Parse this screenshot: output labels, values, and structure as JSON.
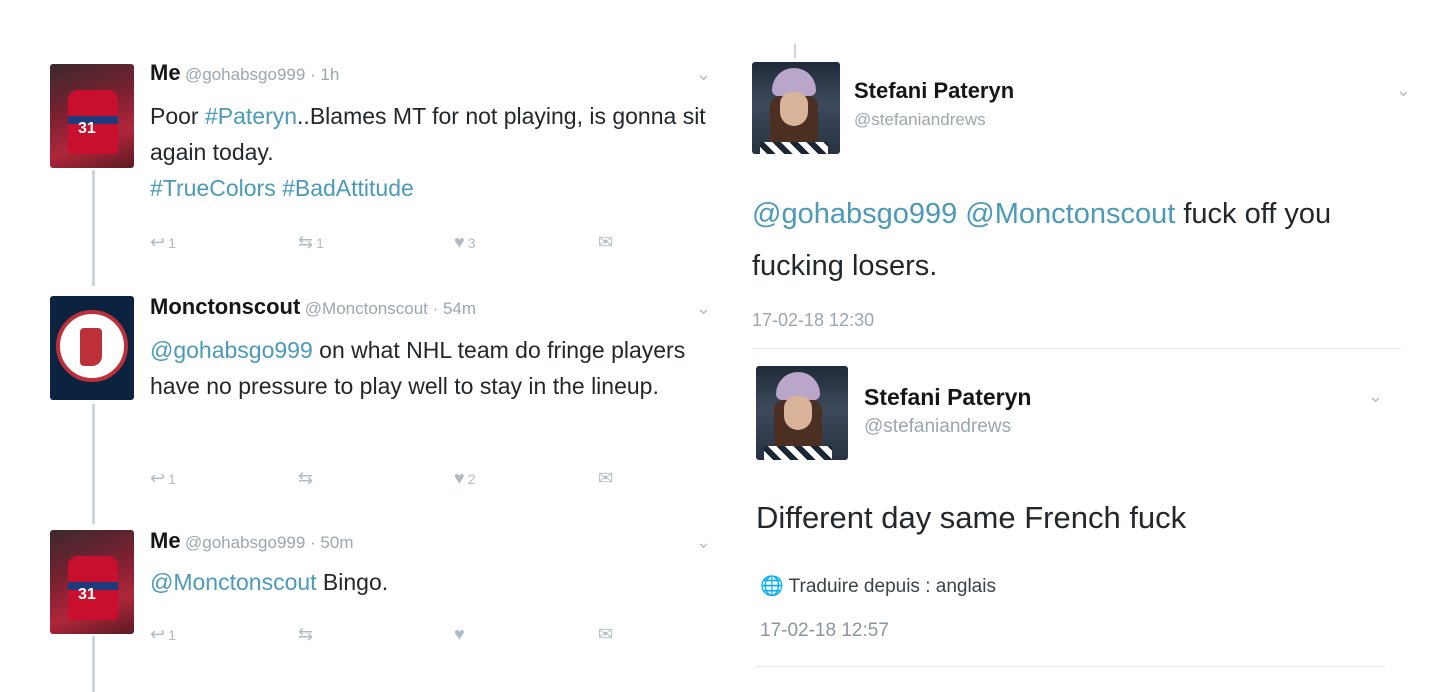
{
  "left_thread": {
    "tweets": [
      {
        "name": "Me",
        "meta": "@gohabsgo999 · 1h",
        "text_parts": [
          {
            "t": "Poor ",
            "link": false
          },
          {
            "t": "#Pateryn",
            "link": true
          },
          {
            "t": "..Blames MT for not playing, is gonna sit again today.",
            "link": false
          }
        ],
        "text_line2": "#TrueColors #BadAttitude",
        "actions": {
          "reply": "1",
          "retweet": "1",
          "like": "3"
        }
      },
      {
        "name": "Monctonscout",
        "meta": "@Monctonscout · 54m",
        "mention": "@gohabsgo999",
        "text": " on what NHL team do fringe players have no pressure to play well to stay in the lineup.",
        "actions": {
          "reply": "1",
          "retweet": "",
          "like": "2"
        }
      },
      {
        "name": "Me",
        "meta": "@gohabsgo999 · 50m",
        "mention": "@Monctonscout",
        "text": " Bingo.",
        "actions": {
          "reply": "1",
          "retweet": "",
          "like": ""
        }
      }
    ]
  },
  "right_tweets": [
    {
      "name": "Stefani Pateryn",
      "handle": "@stefaniandrews",
      "mentions": "@gohabsgo999 @Monctonscout",
      "text": " fuck off you fucking losers.",
      "timestamp": "17-02-18 12:30"
    },
    {
      "name": "Stefani Pateryn",
      "handle": "@stefaniandrews",
      "text": "Different day same French fuck",
      "translate": "Traduire depuis : anglais",
      "timestamp": "17-02-18 12:57"
    }
  ],
  "icons": {
    "reply": "reply-icon",
    "retweet": "retweet-icon",
    "like": "heart-icon",
    "dm": "envelope-icon",
    "chevron": "chevron-down-icon",
    "globe": "globe-icon"
  },
  "colors": {
    "link": "#4a9ab8",
    "muted": "#9aa7b0"
  }
}
